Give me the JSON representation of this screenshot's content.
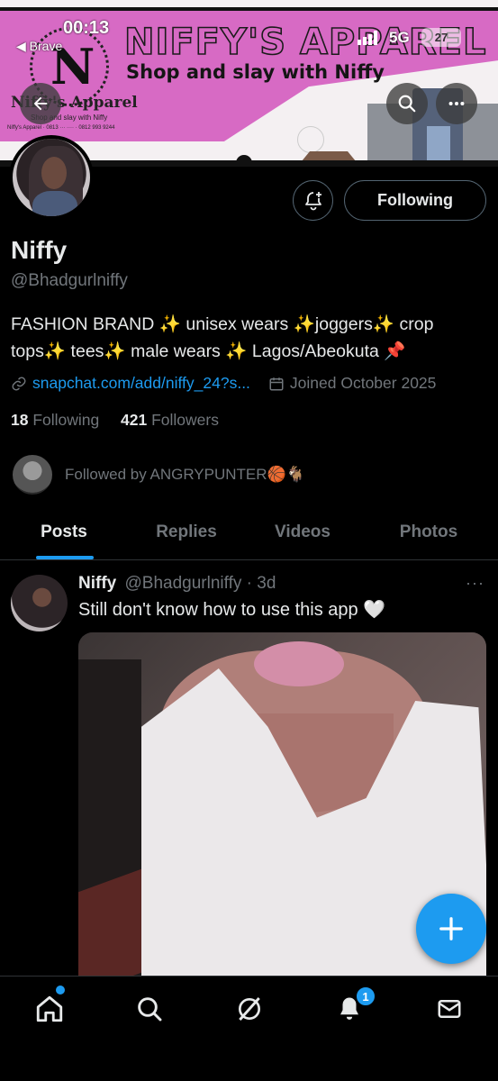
{
  "status_bar": {
    "time": "00:13",
    "back_app": "Brave",
    "network": "5G",
    "battery": "27"
  },
  "banner": {
    "title": "NIFFY'S APPAREL",
    "subtitle": "Shop and slay with Niffy",
    "logo_letter": "N",
    "logo_name": "Niffy's Apparel",
    "logo_tagline": "Shop and slay with Niffy",
    "logo_contact": "Niffy's Apparel · 0813 ··· ···· · 0812 993 9244"
  },
  "profile": {
    "name": "Niffy",
    "handle": "@Bhadgurlniffy",
    "bio": "FASHION BRAND ✨ unisex wears ✨joggers✨ crop tops✨ tees✨ male wears ✨ Lagos/Abeokuta 📌",
    "link": "snapchat.com/add/niffy_24?s...",
    "joined": "Joined October 2025",
    "following_count": "18",
    "following_label": "Following",
    "followers_count": "421",
    "followers_label": "Followers",
    "followed_by": "Followed by ANGRYPUNTER🏀🐐",
    "follow_button": "Following"
  },
  "tabs": [
    {
      "label": "Posts",
      "active": true
    },
    {
      "label": "Replies",
      "active": false
    },
    {
      "label": "Videos",
      "active": false
    },
    {
      "label": "Photos",
      "active": false
    }
  ],
  "post": {
    "author": "Niffy",
    "handle": "@Bhadgurlniffy",
    "separator": "·",
    "time": "3d",
    "text": "Still don't know how to use this app 🤍",
    "more": "···"
  },
  "nav": {
    "notifications_badge": "1"
  },
  "colors": {
    "accent": "#1d9bf0",
    "background": "#000000",
    "banner_pink": "#d76ac4",
    "muted_text": "#71767b"
  }
}
